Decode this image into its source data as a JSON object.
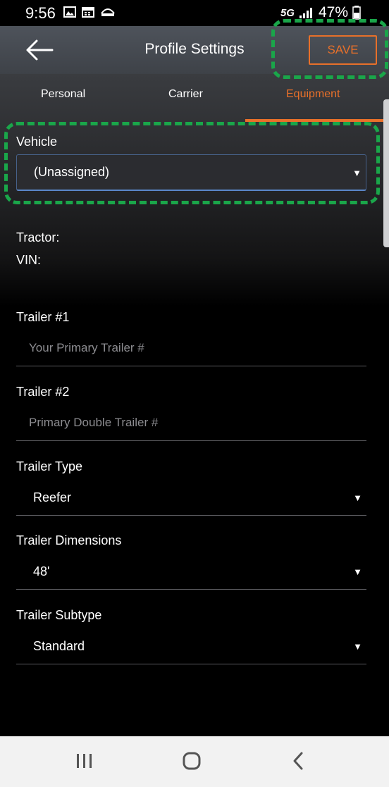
{
  "status_bar": {
    "time": "9:56",
    "network": "5G",
    "battery": "47%"
  },
  "header": {
    "title": "Profile Settings",
    "save_label": "SAVE"
  },
  "tabs": [
    {
      "label": "Personal",
      "active": false
    },
    {
      "label": "Carrier",
      "active": false
    },
    {
      "label": "Equipment",
      "active": true
    }
  ],
  "vehicle": {
    "label": "Vehicle",
    "value": "(Unassigned)"
  },
  "tractor_label": "Tractor:",
  "vin_label": "VIN:",
  "trailer1": {
    "label": "Trailer #1",
    "value": "",
    "placeholder": "Your Primary Trailer #"
  },
  "trailer2": {
    "label": "Trailer #2",
    "value": "",
    "placeholder": "Primary Double Trailer #"
  },
  "trailer_type": {
    "label": "Trailer Type",
    "value": "Reefer"
  },
  "trailer_dimensions": {
    "label": "Trailer Dimensions",
    "value": "48'"
  },
  "trailer_subtype": {
    "label": "Trailer Subtype",
    "value": "Standard"
  },
  "colors": {
    "accent": "#e8702a",
    "highlight": "#1aa64a",
    "header_bg": "#4a4e55",
    "focus_underline": "#5a86c8"
  },
  "icons": [
    "back-arrow-icon",
    "recents-icon",
    "home-icon",
    "back-nav-icon",
    "dropdown-caret-icon"
  ]
}
